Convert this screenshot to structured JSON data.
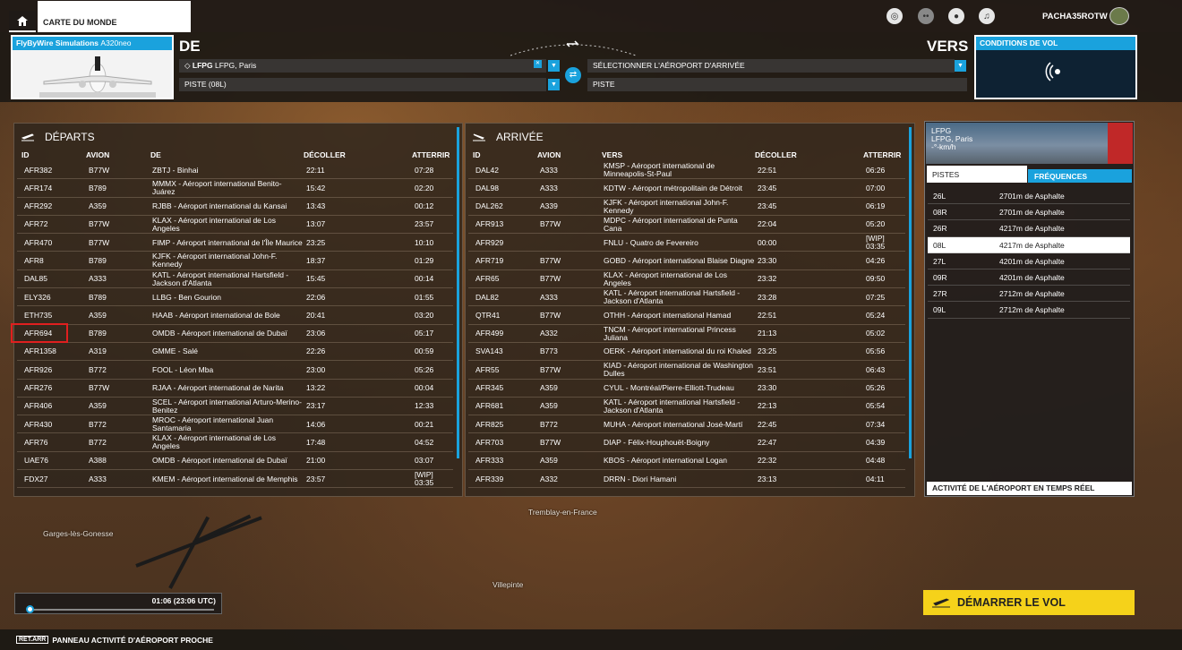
{
  "topbar": {
    "world_tab": "CARTE DU MONDE",
    "username": "PACHA35ROTW"
  },
  "flight": {
    "aircraft_brand": "FlyByWire Simulations",
    "aircraft_model": "A320neo",
    "de_label": "DE",
    "vers_label": "VERS",
    "origin_code": "LFPG",
    "origin_name": "LFPG, Paris",
    "origin_runway": "PISTE (08L)",
    "dest_placeholder": "SÉLECTIONNER L'AÉROPORT D'ARRIVÉE",
    "dest_runway": "PISTE",
    "conditions_label": "CONDITIONS DE VOL"
  },
  "departures": {
    "title": "DÉPARTS",
    "headers": [
      "ID",
      "AVION",
      "DE",
      "DÉCOLLER",
      "ATTERRIR"
    ],
    "rows": [
      [
        "AFR382",
        "B77W",
        "ZBTJ - Binhai",
        "22:11",
        "07:28"
      ],
      [
        "AFR174",
        "B789",
        "MMMX - Aéroport international Benito-Juárez",
        "15:42",
        "02:20"
      ],
      [
        "AFR292",
        "A359",
        "RJBB - Aéroport international du Kansai",
        "13:43",
        "00:12"
      ],
      [
        "AFR72",
        "B77W",
        "KLAX - Aéroport international de Los Angeles",
        "13:07",
        "23:57"
      ],
      [
        "AFR470",
        "B77W",
        "FIMP - Aéroport international de l'Île Maurice",
        "23:25",
        "10:10"
      ],
      [
        "AFR8",
        "B789",
        "KJFK - Aéroport international John-F. Kennedy",
        "18:37",
        "01:29"
      ],
      [
        "DAL85",
        "A333",
        "KATL - Aéroport international Hartsfield - Jackson d'Atlanta",
        "15:45",
        "00:14"
      ],
      [
        "ELY326",
        "B789",
        "LLBG - Ben Gourion",
        "22:06",
        "01:55"
      ],
      [
        "ETH735",
        "A359",
        "HAAB - Aéroport international de Bole",
        "20:41",
        "03:20"
      ],
      [
        "AFR694",
        "B789",
        "OMDB - Aéroport international de Dubaï",
        "23:06",
        "05:17"
      ],
      [
        "AFR1358",
        "A319",
        "GMME - Salé",
        "22:26",
        "00:59"
      ],
      [
        "AFR926",
        "B772",
        "FOOL - Léon Mba",
        "23:00",
        "05:26"
      ],
      [
        "AFR276",
        "B77W",
        "RJAA - Aéroport international de Narita",
        "13:22",
        "00:04"
      ],
      [
        "AFR406",
        "A359",
        "SCEL - Aéroport international Arturo-Merino-Benitez",
        "23:17",
        "12:33"
      ],
      [
        "AFR430",
        "B772",
        "MROC - Aéroport international Juan Santamaria",
        "14:06",
        "00:21"
      ],
      [
        "AFR76",
        "B772",
        "KLAX - Aéroport international de Los Angeles",
        "17:48",
        "04:52"
      ],
      [
        "UAE76",
        "A388",
        "OMDB - Aéroport international de Dubaï",
        "21:00",
        "03:07"
      ],
      [
        "FDX27",
        "A333",
        "KMEM - Aéroport international de Memphis",
        "23:57",
        "[WIP] 03:35"
      ]
    ]
  },
  "arrivals": {
    "title": "ARRIVÉE",
    "headers": [
      "ID",
      "AVION",
      "VERS",
      "DÉCOLLER",
      "ATTERRIR"
    ],
    "rows": [
      [
        "DAL42",
        "A333",
        "KMSP - Aéroport international de Minneapolis-St-Paul",
        "22:51",
        "06:26"
      ],
      [
        "DAL98",
        "A333",
        "KDTW - Aéroport métropolitain de Détroit",
        "23:45",
        "07:00"
      ],
      [
        "DAL262",
        "A339",
        "KJFK - Aéroport international John-F. Kennedy",
        "23:45",
        "06:19"
      ],
      [
        "AFR913",
        "B77W",
        "MDPC - Aéroport international de Punta Cana",
        "22:04",
        "05:20"
      ],
      [
        "AFR929",
        "",
        "FNLU - Quatro de Fevereiro",
        "00:00",
        "[WIP] 03:35"
      ],
      [
        "AFR719",
        "B77W",
        "GOBD - Aéroport international Blaise Diagne",
        "23:30",
        "04:26"
      ],
      [
        "AFR65",
        "B77W",
        "KLAX - Aéroport international de Los Angeles",
        "23:32",
        "09:50"
      ],
      [
        "DAL82",
        "A333",
        "KATL - Aéroport international Hartsfield - Jackson d'Atlanta",
        "23:28",
        "07:25"
      ],
      [
        "QTR41",
        "B77W",
        "OTHH - Aéroport international Hamad",
        "22:51",
        "05:24"
      ],
      [
        "AFR499",
        "A332",
        "TNCM - Aéroport international Princess Juliana",
        "21:13",
        "05:02"
      ],
      [
        "SVA143",
        "B773",
        "OERK - Aéroport international du roi Khaled",
        "23:25",
        "05:56"
      ],
      [
        "AFR55",
        "B77W",
        "KIAD - Aéroport international de Washington Dulles",
        "23:51",
        "06:43"
      ],
      [
        "AFR345",
        "A359",
        "CYUL - Montréal/Pierre-Elliott-Trudeau",
        "23:30",
        "05:26"
      ],
      [
        "AFR681",
        "A359",
        "KATL - Aéroport international Hartsfield - Jackson d'Atlanta",
        "22:13",
        "05:54"
      ],
      [
        "AFR825",
        "B772",
        "MUHA - Aéroport international José-Martí",
        "22:45",
        "07:34"
      ],
      [
        "AFR703",
        "B77W",
        "DIAP - Félix-Houphouët-Boigny",
        "22:47",
        "04:39"
      ],
      [
        "AFR333",
        "A359",
        "KBOS - Aéroport international Logan",
        "22:32",
        "04:48"
      ],
      [
        "AFR339",
        "A332",
        "DRRN - Diori Hamani",
        "23:13",
        "04:11"
      ]
    ]
  },
  "airport": {
    "code": "LFPG",
    "name": "LFPG, Paris",
    "wind": "-°-km/h",
    "tab_pistes": "PISTES",
    "tab_freq": "FRÉQUENCES",
    "runways": [
      [
        "26L",
        "2701m de Asphalte"
      ],
      [
        "08R",
        "2701m de Asphalte"
      ],
      [
        "26R",
        "4217m de Asphalte"
      ],
      [
        "08L",
        "4217m de Asphalte"
      ],
      [
        "27L",
        "4201m de Asphalte"
      ],
      [
        "09R",
        "4201m de Asphalte"
      ],
      [
        "27R",
        "2712m de Asphalte"
      ],
      [
        "09L",
        "2712m de Asphalte"
      ]
    ],
    "selected_runway": "08L",
    "activity_label": "ACTIVITÉ DE L'AÉROPORT EN TEMPS RÉEL"
  },
  "map": {
    "places": [
      "Garges-lès-Gonesse",
      "Tremblay-en-France",
      "Villepinte"
    ]
  },
  "time": {
    "display": "01:06 (23:06 UTC)"
  },
  "actions": {
    "start_flight": "DÉMARRER LE VOL"
  },
  "bottombar": {
    "key": "RET.ARR",
    "label": "PANNEAU ACTIVITÉ D'AÉROPORT PROCHE"
  },
  "colors": {
    "accent": "#1aa2dd",
    "start_button": "#f5d21a",
    "highlight": "#e01f1f"
  }
}
